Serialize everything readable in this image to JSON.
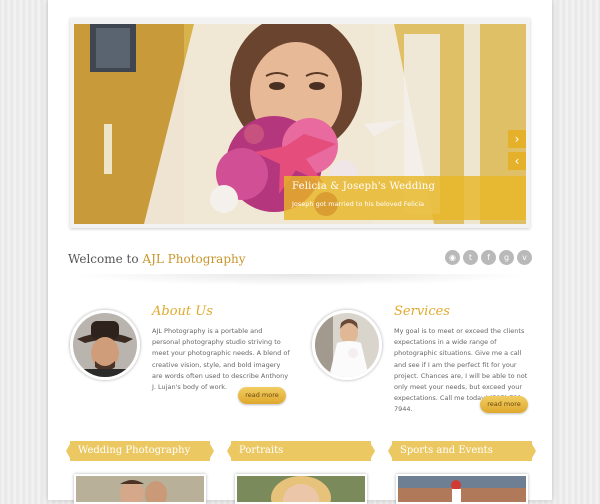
{
  "slider": {
    "caption_title": "Felicia & Joseph's Wedding",
    "caption_text": "Joseph got married to his beloved Felicia",
    "next_arrow": "›",
    "prev_arrow": "‹"
  },
  "welcome": {
    "prefix": "Welcome to",
    "brand": "AJL Photography"
  },
  "social_icons": [
    "rss-icon",
    "twitter-icon",
    "facebook-icon",
    "google-icon",
    "vimeo-icon"
  ],
  "about": {
    "title": "About Us",
    "body": "AJL Photography is a portable and personal photography studio striving to meet your photographic needs. A blend of creative vision, style, and bold imagery are words often used to describe Anthony J. Lujan's body of work.",
    "read_more": "read more"
  },
  "services": {
    "title": "Services",
    "body": "My goal is to meet or exceed the clients expectations in a wide range of photographic situations. Give me a call and see if I am the perfect fit for your project. Chances are, I will be able to not only meet your needs, but exceed your expectations. Call me today! (505) 721-7944.",
    "read_more": "read more"
  },
  "columns": [
    {
      "title": "Wedding Photography"
    },
    {
      "title": "Portraits"
    },
    {
      "title": "Sports and Events"
    }
  ],
  "colors": {
    "accent": "#e6b12a",
    "ribbon": "#ecc862",
    "brand_text": "#c8962a",
    "title_italic": "#e0a92d"
  }
}
